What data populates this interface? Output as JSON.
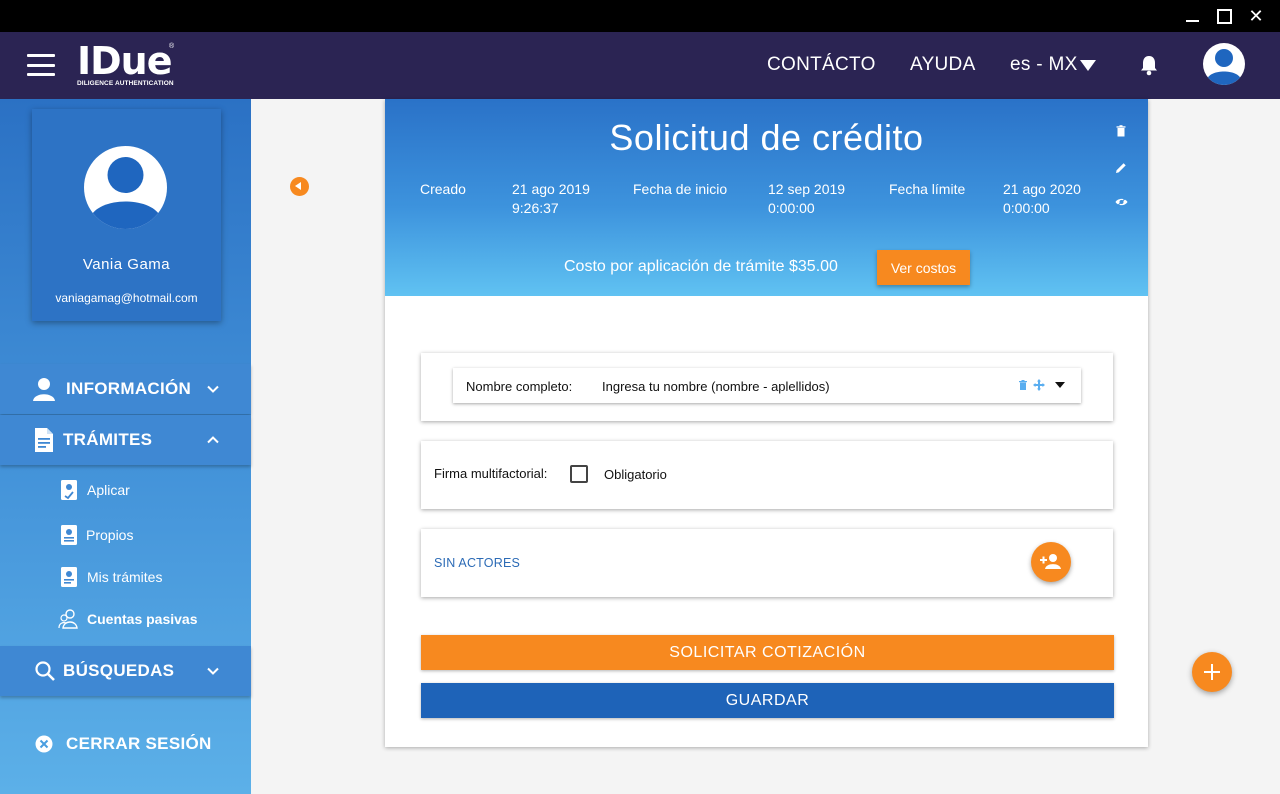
{
  "window": {
    "close_glyph": "✕"
  },
  "topnav": {
    "logo": "IDue",
    "logo_sub": "DILIGENCE AUTHENTICATION",
    "logo_reg": "®",
    "contacto": "CONTÁCTO",
    "ayuda": "AYUDA",
    "lang": "es - MX"
  },
  "sidebar": {
    "profile": {
      "name": "Vania Gama",
      "email": "vaniagamag@hotmail.com"
    },
    "informacion": "INFORMACIÓN",
    "tramites": "TRÁMITES",
    "sub_items": [
      {
        "label": "Aplicar",
        "icon": "id-card-check-icon"
      },
      {
        "label": "Propios",
        "icon": "id-card-icon"
      },
      {
        "label": "Mis trámites",
        "icon": "id-card-search-icon"
      },
      {
        "label": "Cuentas pasivas",
        "icon": "users-outline-icon"
      }
    ],
    "busquedas": "BÚSQUEDAS",
    "cerrar_sesion": "CERRAR SESIÓN"
  },
  "card": {
    "title": "Solicitud de crédito",
    "created_label": "Creado",
    "created_date": "21 ago 2019",
    "created_time": "9:26:37",
    "start_label": "Fecha de inicio",
    "start_date": "12 sep 2019",
    "start_time": "0:00:00",
    "limit_label": "Fecha límite",
    "limit_date": "21 ago 2020",
    "limit_time": "0:00:00",
    "cost_text": "Costo por aplicación de trámite $35.00",
    "ver_costos": "Ver costos",
    "nombre_label": "Nombre completo:",
    "nombre_value": "Ingresa tu nombre (nombre - aplellidos)",
    "firma_label": "Firma multifactorial:",
    "obligatorio": "Obligatorio",
    "sin_actores": "SIN ACTORES",
    "solicitar": "SOLICITAR COTIZACIÓN",
    "guardar": "GUARDAR"
  },
  "colors": {
    "nav": "#2b2453",
    "accent": "#f7891f",
    "primary": "#1e63b8",
    "link": "#2c6bb6"
  }
}
